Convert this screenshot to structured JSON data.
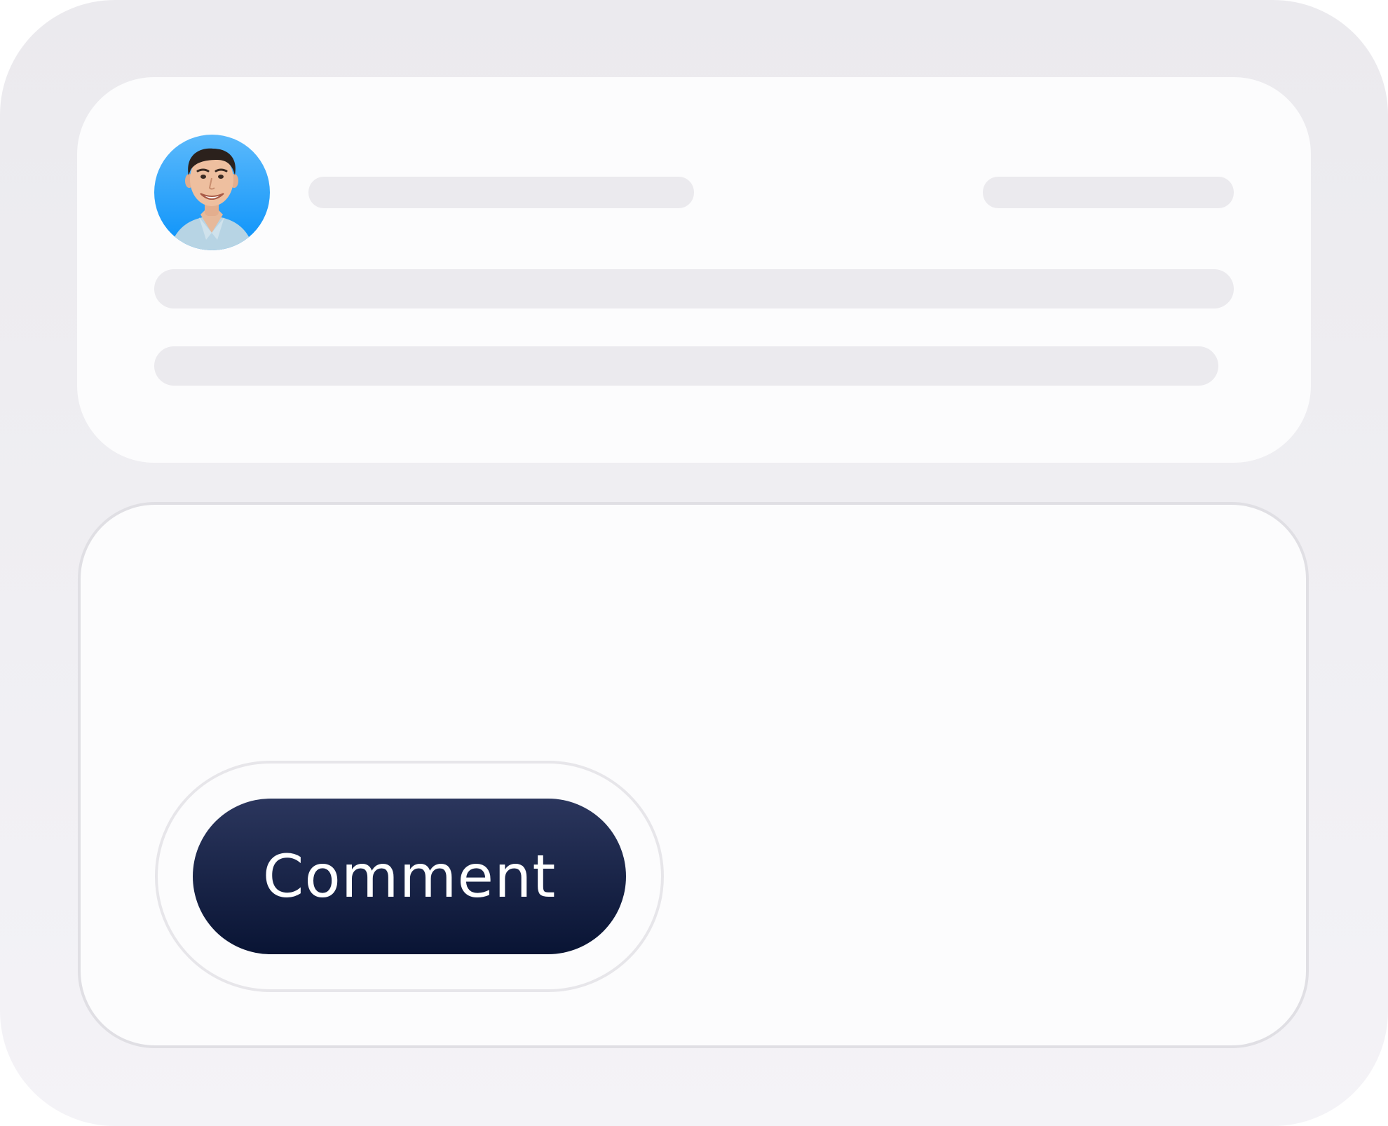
{
  "post": {
    "author_avatar": "user-avatar-photo"
  },
  "composer": {
    "submit_label": "Comment"
  },
  "colors": {
    "frame_background": "#ebeaee",
    "card_background": "#fcfcfd",
    "skeleton": "#ebeaee",
    "avatar_background": "#0a92fa",
    "button_background": "#1a244a",
    "button_text": "#ffffff"
  }
}
